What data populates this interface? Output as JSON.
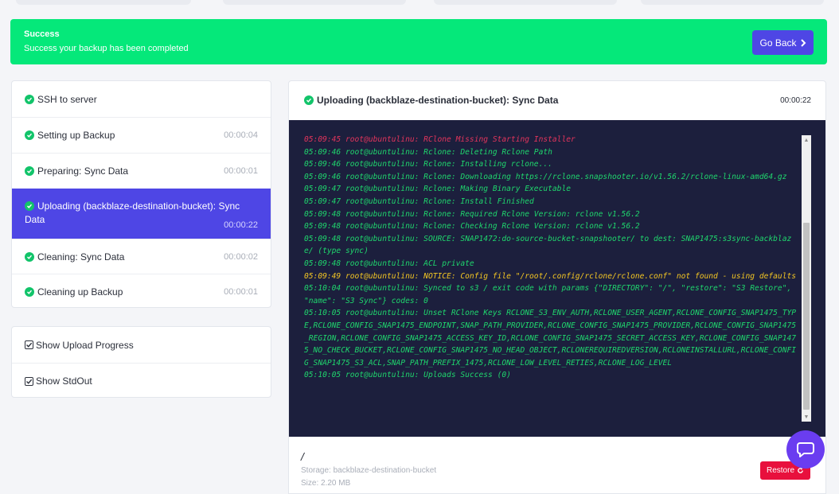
{
  "alert": {
    "title": "Success",
    "message": "Success your backup has been completed",
    "go_back_label": "Go Back",
    "color": "#05e87a"
  },
  "steps": [
    {
      "label": "SSH to server",
      "time": ""
    },
    {
      "label": "Setting up Backup",
      "time": "00:00:04"
    },
    {
      "label": "Preparing: Sync Data",
      "time": "00:00:01"
    },
    {
      "label_line1": "Uploading (backblaze-destination-bucket): Sync",
      "label_line2": "Data",
      "time": "00:00:22",
      "active": true
    },
    {
      "label": "Cleaning: Sync Data",
      "time": "00:00:02"
    },
    {
      "label": "Cleaning up Backup",
      "time": "00:00:01"
    }
  ],
  "options": {
    "upload_progress_label": "Show Upload Progress",
    "stdout_label": "Show StdOut"
  },
  "panel": {
    "title": "Uploading (backblaze-destination-bucket): Sync Data",
    "time": "00:00:22"
  },
  "log": [
    {
      "kind": "err",
      "text": "05:09:45 root@ubuntulinu: RClone Missing Starting Installer"
    },
    {
      "kind": "ok",
      "text": "05:09:46 root@ubuntulinu: Rclone: Deleting Rclone Path"
    },
    {
      "kind": "ok",
      "text": "05:09:46 root@ubuntulinu: Rclone: Installing rclone..."
    },
    {
      "kind": "ok",
      "text": "05:09:46 root@ubuntulinu: Rclone: Downloading https://rclone.snapshooter.io/v1.56.2/rclone-linux-amd64.gz"
    },
    {
      "kind": "ok",
      "text": "05:09:47 root@ubuntulinu: Rclone: Making Binary Executable"
    },
    {
      "kind": "ok",
      "text": "05:09:47 root@ubuntulinu: Rclone: Install Finished"
    },
    {
      "kind": "ok",
      "text": "05:09:48 root@ubuntulinu: Rclone: Required Rclone Version: rclone v1.56.2"
    },
    {
      "kind": "ok",
      "text": "05:09:48 root@ubuntulinu: Rclone: Checking Rclone Version: rclone v1.56.2"
    },
    {
      "kind": "ok",
      "text": "05:09:48 root@ubuntulinu: SOURCE: SNAP1472:do-source-bucket-snapshooter/ to dest: SNAP1475:s3sync-backblaze/ (type sync)"
    },
    {
      "kind": "ok",
      "text": "05:09:48 root@ubuntulinu: ACL private"
    },
    {
      "kind": "warn",
      "text": "05:09:49 root@ubuntulinu: NOTICE: Config file \"/root/.config/rclone/rclone.conf\" not found - using defaults"
    },
    {
      "kind": "ok",
      "text": "05:10:04 root@ubuntulinu: Synced to s3 / exit code with params {\"DIRECTORY\": \"/\", \"restore\": \"S3 Restore\", \"name\": \"S3 Sync\"} codes: 0"
    },
    {
      "kind": "ok",
      "text": "05:10:05 root@ubuntulinu: Unset RClone Keys RCLONE_S3_ENV_AUTH,RCLONE_USER_AGENT,RCLONE_CONFIG_SNAP1475_TYPE,RCLONE_CONFIG_SNAP1475_ENDPOINT,SNAP_PATH_PROVIDER,RCLONE_CONFIG_SNAP1475_PROVIDER,RCLONE_CONFIG_SNAP1475_REGION,RCLONE_CONFIG_SNAP1475_ACCESS_KEY_ID,RCLONE_CONFIG_SNAP1475_SECRET_ACCESS_KEY,RCLONE_CONFIG_SNAP1475_NO_CHECK_BUCKET,RCLONE_CONFIG_SNAP1475_NO_HEAD_OBJECT,RCLONEREQUIREDVERSION,RCLONEINSTALLURL,RCLONE_CONFIG_SNAP1475_S3_ACL,SNAP_PATH_PREFIX_1475,RCLONE_LOW_LEVEL_RETIES,RCLONE_LOG_LEVEL"
    },
    {
      "kind": "ok",
      "text": "05:10:05 root@ubuntulinu: Uploads Success (0)"
    }
  ],
  "footer": {
    "path": "/",
    "storage": "Storage: backblaze-destination-bucket",
    "size": "Size: 2.20 MB",
    "restore_label": "Restore"
  },
  "colors": {
    "accent": "#4e46e5",
    "success": "#12c46a",
    "danger": "#e8103d",
    "console_bg": "#1c1f3d"
  }
}
